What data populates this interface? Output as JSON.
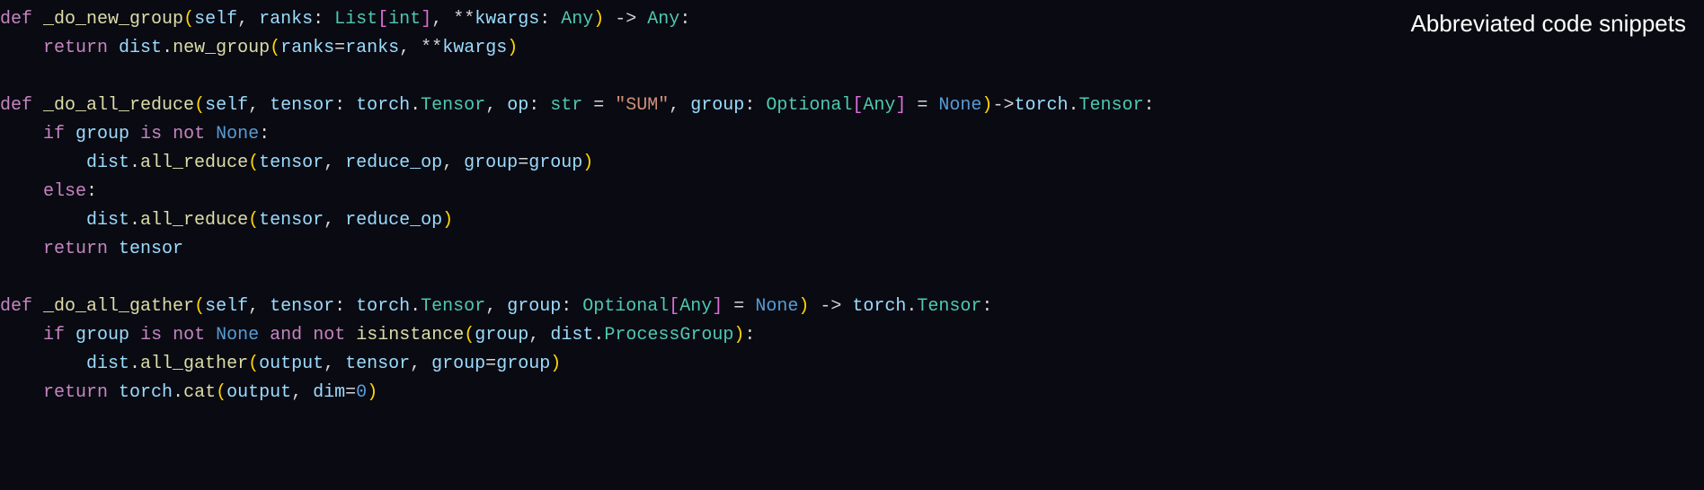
{
  "annotation": "Abbreviated code snippets",
  "code": {
    "fn1_def": "def",
    "fn1_name": "_do_new_group",
    "fn1_self": "self",
    "fn1_p_ranks": "ranks",
    "fn1_t_List": "List",
    "fn1_t_int": "int",
    "fn1_p_kwargs": "kwargs",
    "fn1_t_Any": "Any",
    "fn1_ret_Any": "Any",
    "fn1_return": "return",
    "fn1_dist": "dist",
    "fn1_new_group": "new_group",
    "fn1_kw_ranks": "ranks",
    "fn1_arg_ranks": "ranks",
    "fn1_kw_kwargs": "kwargs",
    "fn2_def": "def",
    "fn2_name": "_do_all_reduce",
    "fn2_self": "self",
    "fn2_p_tensor": "tensor",
    "fn2_t_torch": "torch",
    "fn2_t_Tensor": "Tensor",
    "fn2_p_op": "op",
    "fn2_t_str": "str",
    "fn2_str_SUM": "\"SUM\"",
    "fn2_p_group": "group",
    "fn2_t_Optional": "Optional",
    "fn2_t_Any": "Any",
    "fn2_None": "None",
    "fn2_ret_torch": "torch",
    "fn2_ret_Tensor": "Tensor",
    "fn2_if": "if",
    "fn2_group1": "group",
    "fn2_is1": "is",
    "fn2_not1": "not",
    "fn2_None1": "None",
    "fn2_dist1": "dist",
    "fn2_all_reduce1": "all_reduce",
    "fn2_arg_tensor1": "tensor",
    "fn2_arg_reduce_op1": "reduce_op",
    "fn2_kw_group1": "group",
    "fn2_val_group1": "group",
    "fn2_else": "else",
    "fn2_dist2": "dist",
    "fn2_all_reduce2": "all_reduce",
    "fn2_arg_tensor2": "tensor",
    "fn2_arg_reduce_op2": "reduce_op",
    "fn2_return": "return",
    "fn2_ret_tensor": "tensor",
    "fn3_def": "def",
    "fn3_name": "_do_all_gather",
    "fn3_self": "self",
    "fn3_p_tensor": "tensor",
    "fn3_t_torch": "torch",
    "fn3_t_Tensor": "Tensor",
    "fn3_p_group": "group",
    "fn3_t_Optional": "Optional",
    "fn3_t_Any": "Any",
    "fn3_None": "None",
    "fn3_ret_torch": "torch",
    "fn3_ret_Tensor": "Tensor",
    "fn3_if": "if",
    "fn3_group1": "group",
    "fn3_is1": "is",
    "fn3_not1": "not",
    "fn3_None1": "None",
    "fn3_and": "and",
    "fn3_not2": "not",
    "fn3_isinstance": "isinstance",
    "fn3_arg_group2": "group",
    "fn3_dist1": "dist",
    "fn3_ProcessGroup": "ProcessGroup",
    "fn3_dist2": "dist",
    "fn3_all_gather": "all_gather",
    "fn3_arg_output": "output",
    "fn3_arg_tensor": "tensor",
    "fn3_kw_group": "group",
    "fn3_val_group": "group",
    "fn3_return": "return",
    "fn3_ret_torch2": "torch",
    "fn3_cat": "cat",
    "fn3_arg_output2": "output",
    "fn3_kw_dim": "dim",
    "fn3_val_dim": "0"
  }
}
